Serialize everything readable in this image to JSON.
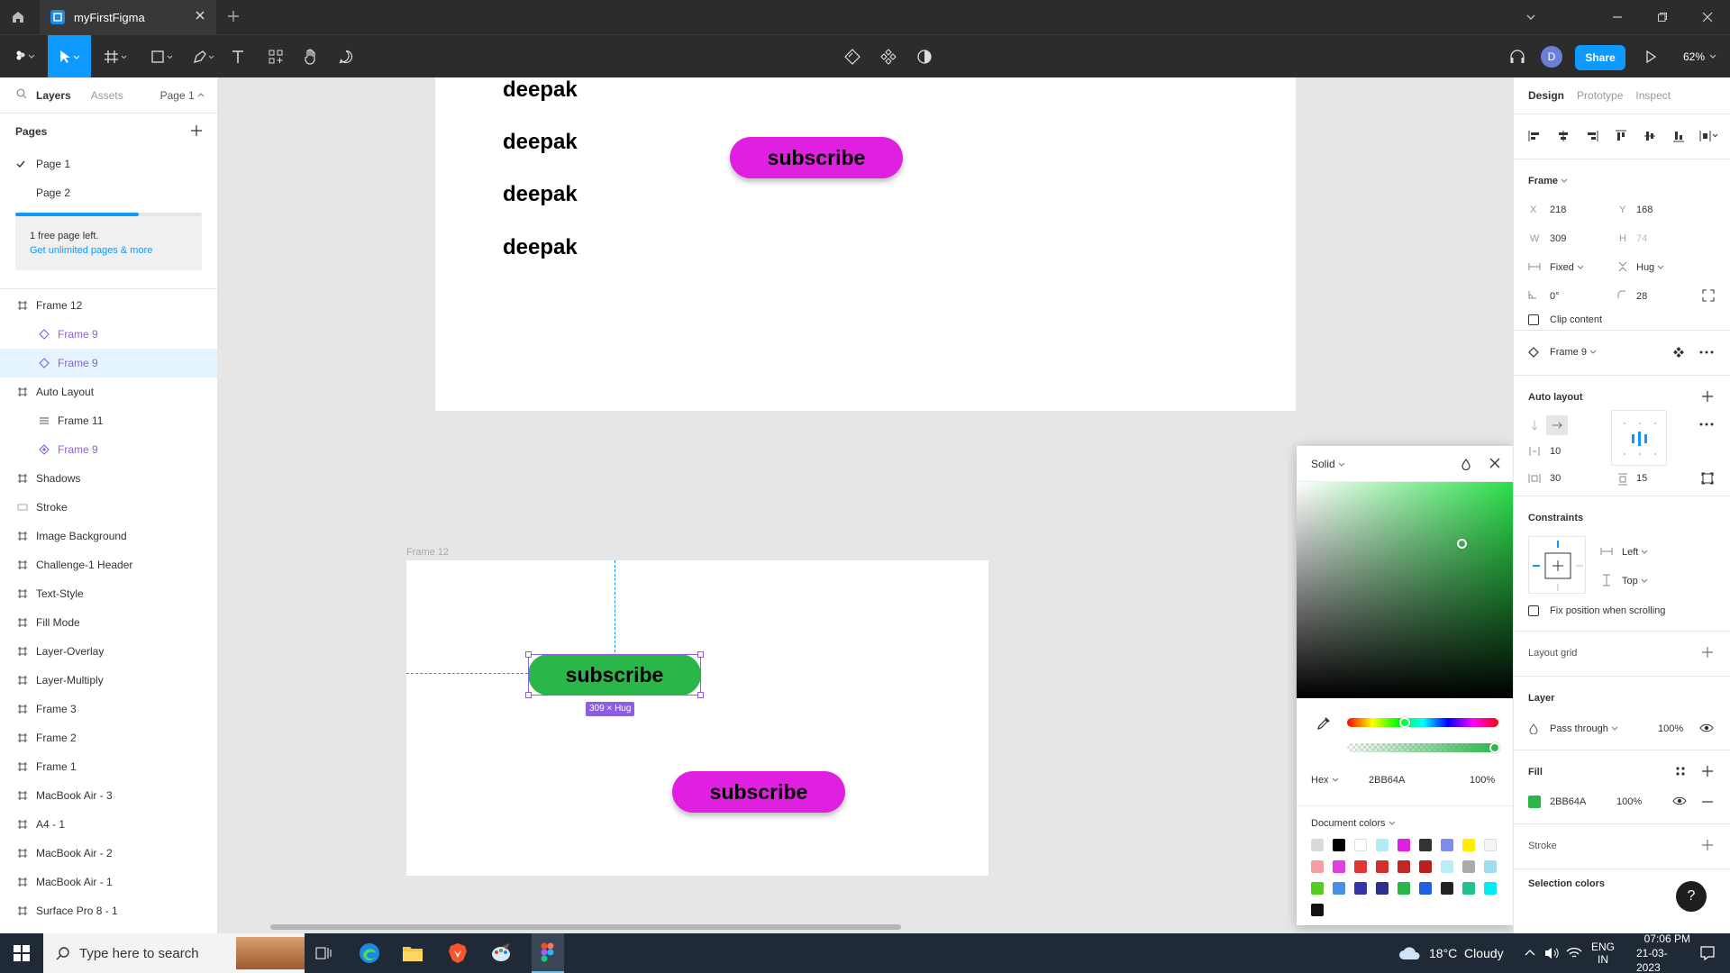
{
  "app": {
    "tab_title": "myFirstFigma"
  },
  "toolbar": {
    "share_label": "Share",
    "avatar_initial": "D",
    "zoom": "62%"
  },
  "left_panel": {
    "tabs": [
      "Layers",
      "Assets"
    ],
    "page_selector": "Page 1",
    "pages_heading": "Pages",
    "pages": [
      "Page 1",
      "Page 2"
    ],
    "pages_used_fraction": 0.66,
    "promo_text": "1 free page left.",
    "promo_link": "Get unlimited pages & more",
    "layers": [
      {
        "name": "Frame 12",
        "kind": "frame",
        "indent": 0
      },
      {
        "name": "Frame 9",
        "kind": "component",
        "indent": 1
      },
      {
        "name": "Frame 9",
        "kind": "component",
        "indent": 1,
        "selected": true
      },
      {
        "name": "Auto Layout",
        "kind": "frame",
        "indent": 0
      },
      {
        "name": "Frame 11",
        "kind": "autolayout",
        "indent": 1
      },
      {
        "name": "Frame 9",
        "kind": "instance",
        "indent": 1
      },
      {
        "name": "Shadows",
        "kind": "frame",
        "indent": 0
      },
      {
        "name": "Stroke",
        "kind": "rect",
        "indent": 0
      },
      {
        "name": "Image Background",
        "kind": "frame",
        "indent": 0
      },
      {
        "name": "Challenge-1 Header",
        "kind": "frame",
        "indent": 0
      },
      {
        "name": "Text-Style",
        "kind": "frame",
        "indent": 0
      },
      {
        "name": "Fill Mode",
        "kind": "frame",
        "indent": 0
      },
      {
        "name": "Layer-Overlay",
        "kind": "frame",
        "indent": 0
      },
      {
        "name": "Layer-Multiply",
        "kind": "frame",
        "indent": 0
      },
      {
        "name": "Frame 3",
        "kind": "frame",
        "indent": 0
      },
      {
        "name": "Frame 2",
        "kind": "frame",
        "indent": 0
      },
      {
        "name": "Frame 1",
        "kind": "frame",
        "indent": 0
      },
      {
        "name": "MacBook Air - 3",
        "kind": "frame",
        "indent": 0
      },
      {
        "name": "A4 - 1",
        "kind": "frame",
        "indent": 0
      },
      {
        "name": "MacBook Air - 2",
        "kind": "frame",
        "indent": 0
      },
      {
        "name": "MacBook Air - 1",
        "kind": "frame",
        "indent": 0
      },
      {
        "name": "Surface Pro 8 - 1",
        "kind": "frame",
        "indent": 0
      }
    ]
  },
  "canvas": {
    "deepak_texts": [
      "deepak",
      "deepak",
      "deepak",
      "deepak"
    ],
    "subscribe_label": "subscribe",
    "frame12_label": "Frame 12",
    "size_badge": "309 × Hug",
    "colors": {
      "magenta": "#e020e0",
      "green": "#2bb64a"
    }
  },
  "picker": {
    "mode": "Solid",
    "hex_mode": "Hex",
    "hex_value": "2BB64A",
    "opacity": "100%",
    "doc_colors_label": "Document colors",
    "swatches": [
      "#d9d9d9",
      "#000000",
      "#ffffff",
      "#b3ecf5",
      "#e020e0",
      "#333333",
      "#7f8fe8",
      "#ffee00",
      "#f5f5f5",
      "#f5a0a0",
      "#e040e0",
      "#e23535",
      "#d03030",
      "#c02828",
      "#b82020",
      "#b8eef5",
      "#aaaaaa",
      "#a0dcef",
      "#55cc22",
      "#4a90e2",
      "#3535a8",
      "#2b3090",
      "#2bb64a",
      "#2060e0",
      "#222222",
      "#20c090",
      "#00eef0",
      "#111111"
    ]
  },
  "right_panel": {
    "tabs": [
      "Design",
      "Prototype",
      "Inspect"
    ],
    "frame_title": "Frame",
    "x": "218",
    "y": "168",
    "w": "309",
    "h": "74",
    "width_mode": "Fixed",
    "height_mode": "Hug",
    "rotation": "0°",
    "radius": "28",
    "clip_content": "Clip content",
    "component_name": "Frame 9",
    "auto_layout_title": "Auto layout",
    "spacing": "10",
    "h_padding": "30",
    "v_padding": "15",
    "constraints_title": "Constraints",
    "constraint_h": "Left",
    "constraint_v": "Top",
    "fix_position": "Fix position when scrolling",
    "layout_grid": "Layout grid",
    "layer_title": "Layer",
    "blend_mode": "Pass through",
    "layer_opacity": "100%",
    "fill_title": "Fill",
    "fill_hex": "2BB64A",
    "fill_opacity": "100%",
    "stroke_title": "Stroke",
    "selection_colors": "Selection colors",
    "help": "?"
  },
  "taskbar": {
    "search_placeholder": "Type here to search",
    "weather": "18°C  Cloudy",
    "lang1": "ENG",
    "lang2": "IN",
    "time": "07:06 PM",
    "date": "21-03-2023"
  }
}
